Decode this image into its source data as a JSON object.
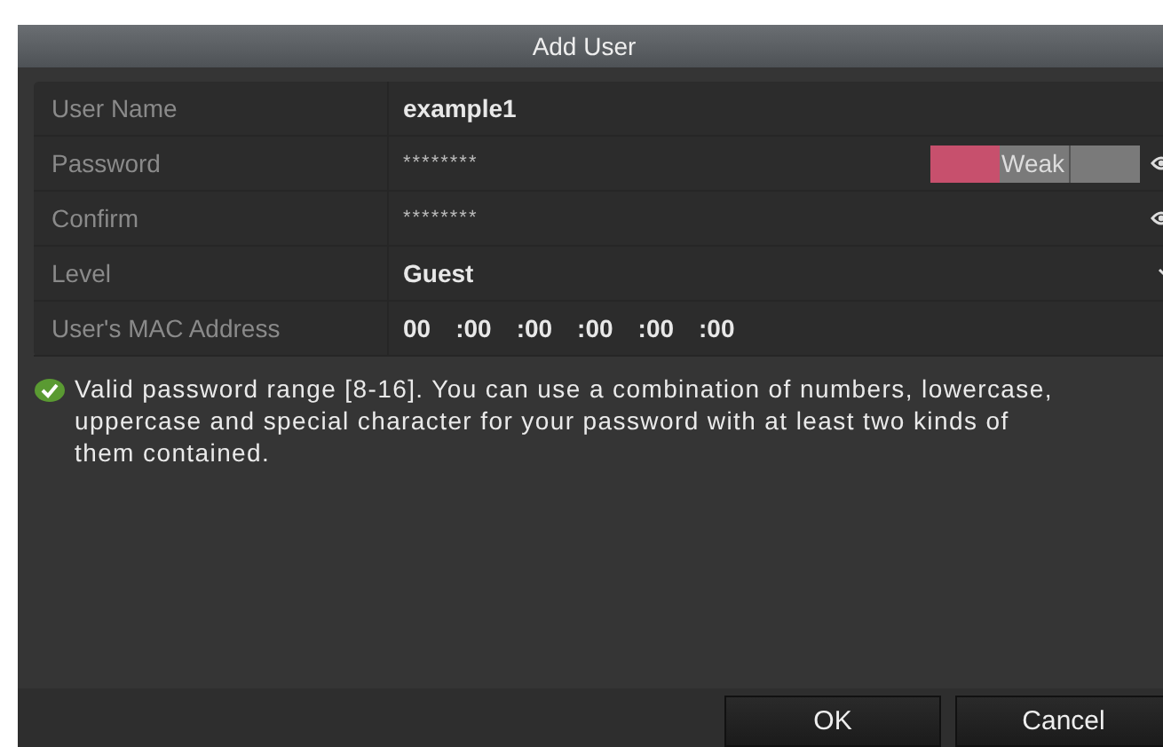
{
  "dialog": {
    "title": "Add User"
  },
  "fields": [
    {
      "kind": "text",
      "label": "User Name",
      "value": "example1"
    },
    {
      "kind": "password",
      "label": "Password",
      "value": "********",
      "strength": {
        "label": "Weak",
        "level": 0.333
      }
    },
    {
      "kind": "password",
      "label": "Confirm",
      "value": "********"
    },
    {
      "kind": "dropdown",
      "label": "Level",
      "value": "Guest"
    },
    {
      "kind": "mac",
      "label": "User's MAC Address",
      "segments": [
        "00",
        ":00",
        ":00",
        ":00",
        ":00",
        ":00"
      ]
    }
  ],
  "hint": {
    "text": "Valid password range [8-16]. You can use a combination of numbers, lowercase, uppercase and special character for your password with at least two kinds of them contained."
  },
  "buttons": [
    {
      "label": "OK"
    },
    {
      "label": "Cancel"
    }
  ]
}
